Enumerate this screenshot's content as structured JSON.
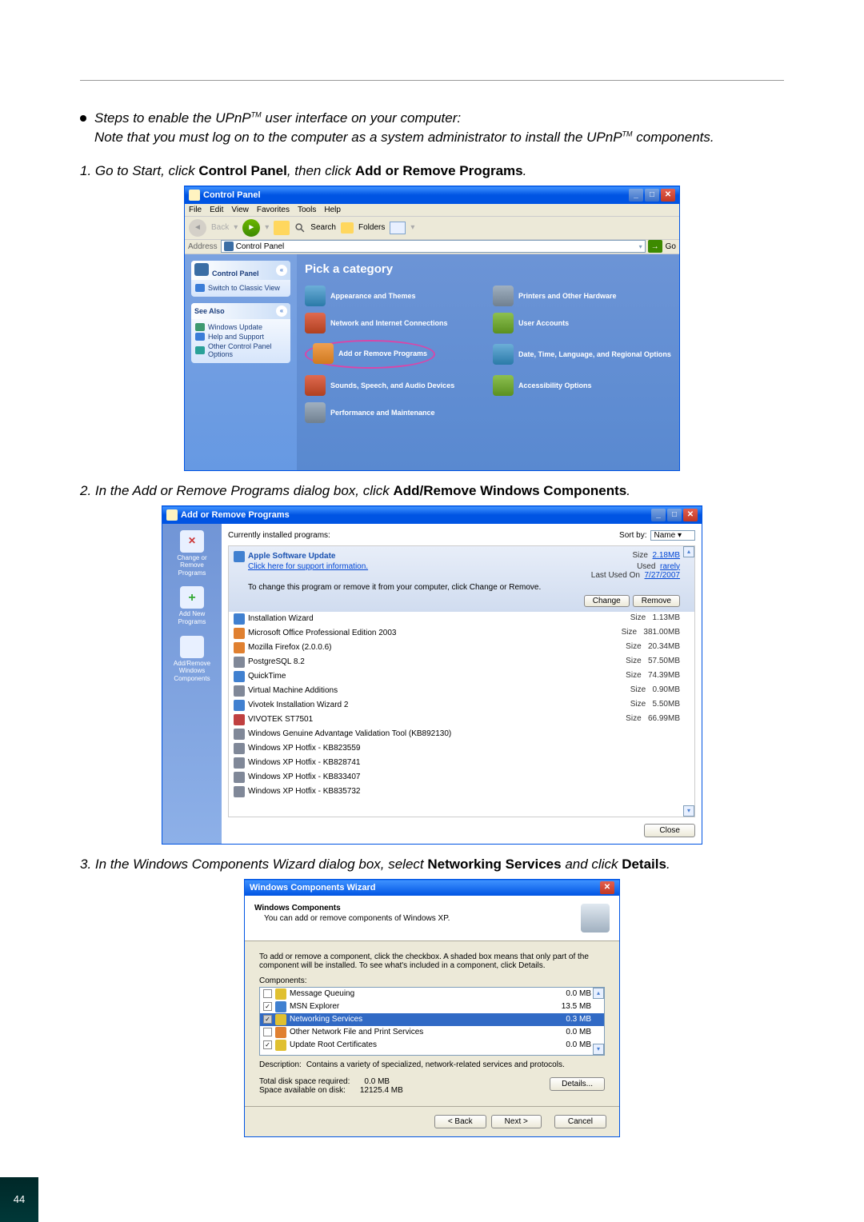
{
  "intro": {
    "bullet": "Steps to enable the UPnP",
    "bullet_rest": " user interface on your computer:",
    "note": "Note that you must log on to the computer as a system administrator to install the UPnP",
    "note_end": " components.",
    "tm": "TM"
  },
  "step1": {
    "num": "1. Go to Start, click ",
    "b1": "Control Panel",
    "mid": ", then click ",
    "b2": "Add or Remove Programs",
    "end": "."
  },
  "step2": {
    "num": "2. In the Add or Remove Programs dialog box, click ",
    "b1": "Add/Remove Windows Components",
    "end": "."
  },
  "step3": {
    "num": "3. In the Windows Components Wizard dialog box, select ",
    "b1": "Networking Services",
    "mid": " and click ",
    "b2": "Details",
    "end": "."
  },
  "cp": {
    "title": "Control Panel",
    "menu": [
      "File",
      "Edit",
      "View",
      "Favorites",
      "Tools",
      "Help"
    ],
    "toolbar": {
      "back": "Back",
      "search": "Search",
      "folders": "Folders"
    },
    "addr_label": "Address",
    "addr_value": "Control Panel",
    "go": "Go",
    "side_title": "Control Panel",
    "side_switch": "Switch to Classic View",
    "see_also": "See Also",
    "side_links": [
      "Windows Update",
      "Help and Support",
      "Other Control Panel Options"
    ],
    "pick": "Pick a category",
    "cats": [
      "Appearance and Themes",
      "Printers and Other Hardware",
      "Network and Internet Connections",
      "User Accounts",
      "Add or Remove Programs",
      "Date, Time, Language, and Regional Options",
      "Sounds, Speech, and Audio Devices",
      "Accessibility Options",
      "Performance and Maintenance"
    ]
  },
  "arp": {
    "title": "Add or Remove Programs",
    "side": [
      "Change or Remove Programs",
      "Add New Programs",
      "Add/Remove Windows Components"
    ],
    "top_label": "Currently installed programs:",
    "sort_by": "Sort by:",
    "sort_val": "Name",
    "sel": {
      "name": "Apple Software Update",
      "support": "Click here for support information.",
      "desc": "To change this program or remove it from your computer, click Change or Remove.",
      "size_l": "Size",
      "size": "2.18MB",
      "used_l": "Used",
      "used": "rarely",
      "last_l": "Last Used On",
      "last": "7/27/2007",
      "change": "Change",
      "remove": "Remove"
    },
    "rows": [
      {
        "name": "Installation Wizard",
        "sl": "Size",
        "size": "1.13MB",
        "ic": "pi-blue"
      },
      {
        "name": "Microsoft Office Professional Edition 2003",
        "sl": "Size",
        "size": "381.00MB",
        "ic": "pi-orange"
      },
      {
        "name": "Mozilla Firefox (2.0.0.6)",
        "sl": "Size",
        "size": "20.34MB",
        "ic": "pi-orange"
      },
      {
        "name": "PostgreSQL 8.2",
        "sl": "Size",
        "size": "57.50MB",
        "ic": "pi-gray"
      },
      {
        "name": "QuickTime",
        "sl": "Size",
        "size": "74.39MB",
        "ic": "pi-blue"
      },
      {
        "name": "Virtual Machine Additions",
        "sl": "Size",
        "size": "0.90MB",
        "ic": "pi-gray"
      },
      {
        "name": "Vivotek Installation Wizard 2",
        "sl": "Size",
        "size": "5.50MB",
        "ic": "pi-blue"
      },
      {
        "name": "VIVOTEK ST7501",
        "sl": "Size",
        "size": "66.99MB",
        "ic": "pi-red"
      },
      {
        "name": "Windows Genuine Advantage Validation Tool (KB892130)",
        "sl": "",
        "size": "",
        "ic": "pi-gray"
      },
      {
        "name": "Windows XP Hotfix - KB823559",
        "sl": "",
        "size": "",
        "ic": "pi-gray"
      },
      {
        "name": "Windows XP Hotfix - KB828741",
        "sl": "",
        "size": "",
        "ic": "pi-gray"
      },
      {
        "name": "Windows XP Hotfix - KB833407",
        "sl": "",
        "size": "",
        "ic": "pi-gray"
      },
      {
        "name": "Windows XP Hotfix - KB835732",
        "sl": "",
        "size": "",
        "ic": "pi-gray"
      }
    ],
    "close": "Close"
  },
  "wcw": {
    "title": "Windows Components Wizard",
    "h_title": "Windows Components",
    "h_sub": "You can add or remove components of Windows XP.",
    "instr": "To add or remove a component, click the checkbox. A shaded box means that only part of the component will be installed. To see what's included in a component, click Details.",
    "components_label": "Components:",
    "items": [
      {
        "name": "Message Queuing",
        "size": "0.0 MB",
        "checked": false,
        "shaded": false,
        "ic": "pi-yellow"
      },
      {
        "name": "MSN Explorer",
        "size": "13.5 MB",
        "checked": true,
        "shaded": false,
        "ic": "pi-blue"
      },
      {
        "name": "Networking Services",
        "size": "0.3 MB",
        "checked": true,
        "shaded": true,
        "selected": true,
        "ic": "pi-yellow"
      },
      {
        "name": "Other Network File and Print Services",
        "size": "0.0 MB",
        "checked": false,
        "shaded": false,
        "ic": "pi-orange"
      },
      {
        "name": "Update Root Certificates",
        "size": "0.0 MB",
        "checked": true,
        "shaded": false,
        "ic": "pi-yellow"
      }
    ],
    "desc_lbl": "Description:",
    "desc": "Contains a variety of specialized, network-related services and protocols.",
    "total_l": "Total disk space required:",
    "total": "0.0 MB",
    "avail_l": "Space available on disk:",
    "avail": "12125.4 MB",
    "details": "Details...",
    "back": "< Back",
    "next": "Next >",
    "cancel": "Cancel"
  },
  "page_num": "44"
}
